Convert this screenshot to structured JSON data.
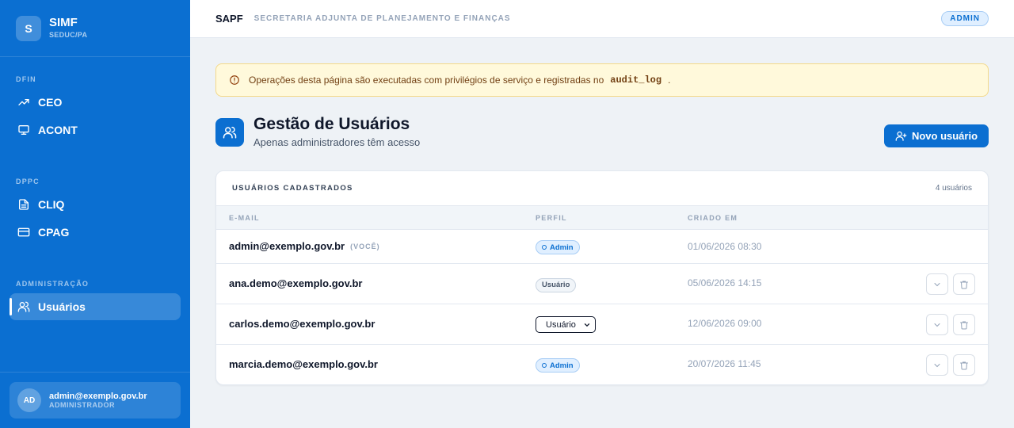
{
  "brand": {
    "logo_letter": "S",
    "name": "SIMF",
    "subtitle": "SEDUC/PA"
  },
  "sidebar": {
    "sections": [
      {
        "label": "DFIN"
      },
      {
        "label": "DPPC"
      },
      {
        "label": "ADMINISTRAÇÃO"
      }
    ],
    "items": [
      {
        "label": "CEO",
        "icon": "trending-up-icon"
      },
      {
        "label": "ACONT",
        "icon": "monitor-icon"
      },
      {
        "label": "CLIQ",
        "icon": "document-icon"
      },
      {
        "label": "CPAG",
        "icon": "credit-card-icon"
      },
      {
        "label": "Usuários",
        "icon": "users-icon",
        "active": true
      }
    ],
    "user": {
      "initials": "AD",
      "email": "admin@exemplo.gov.br",
      "role": "ADMINISTRADOR"
    }
  },
  "topbar": {
    "title": "SAPF",
    "subtitle": "SECRETARIA ADJUNTA DE PLANEJAMENTO E FINANÇAS",
    "badge": "ADMIN"
  },
  "alert": {
    "text_before": "Operações desta página são executadas com privilégios de serviço e registradas no",
    "code": "audit_log",
    "text_after": "."
  },
  "page": {
    "title": "Gestão de Usuários",
    "subtitle": "Apenas administradores têm acesso",
    "new_button": "Novo usuário"
  },
  "table": {
    "title": "USUÁRIOS CADASTRADOS",
    "count": "4 usuários",
    "columns": {
      "email": "E-MAIL",
      "perfil": "PERFIL",
      "criado": "CRIADO EM"
    },
    "rows": [
      {
        "email": "admin@exemplo.gov.br",
        "you": "(VOCÊ)",
        "perfil": "Admin",
        "criado": "01/06/2026 08:30"
      },
      {
        "email": "ana.demo@exemplo.gov.br",
        "perfil": "Usuário",
        "criado": "05/06/2026 14:15"
      },
      {
        "email": "carlos.demo@exemplo.gov.br",
        "perfil": "Usuário",
        "criado": "12/06/2026 09:00"
      },
      {
        "email": "marcia.demo@exemplo.gov.br",
        "perfil": "Admin",
        "criado": "20/07/2026 11:45"
      }
    ]
  },
  "colors": {
    "primary": "#0b6fd1",
    "background": "#eef2f6",
    "alert_bg": "#fff9db",
    "alert_border": "#f3d98a"
  }
}
